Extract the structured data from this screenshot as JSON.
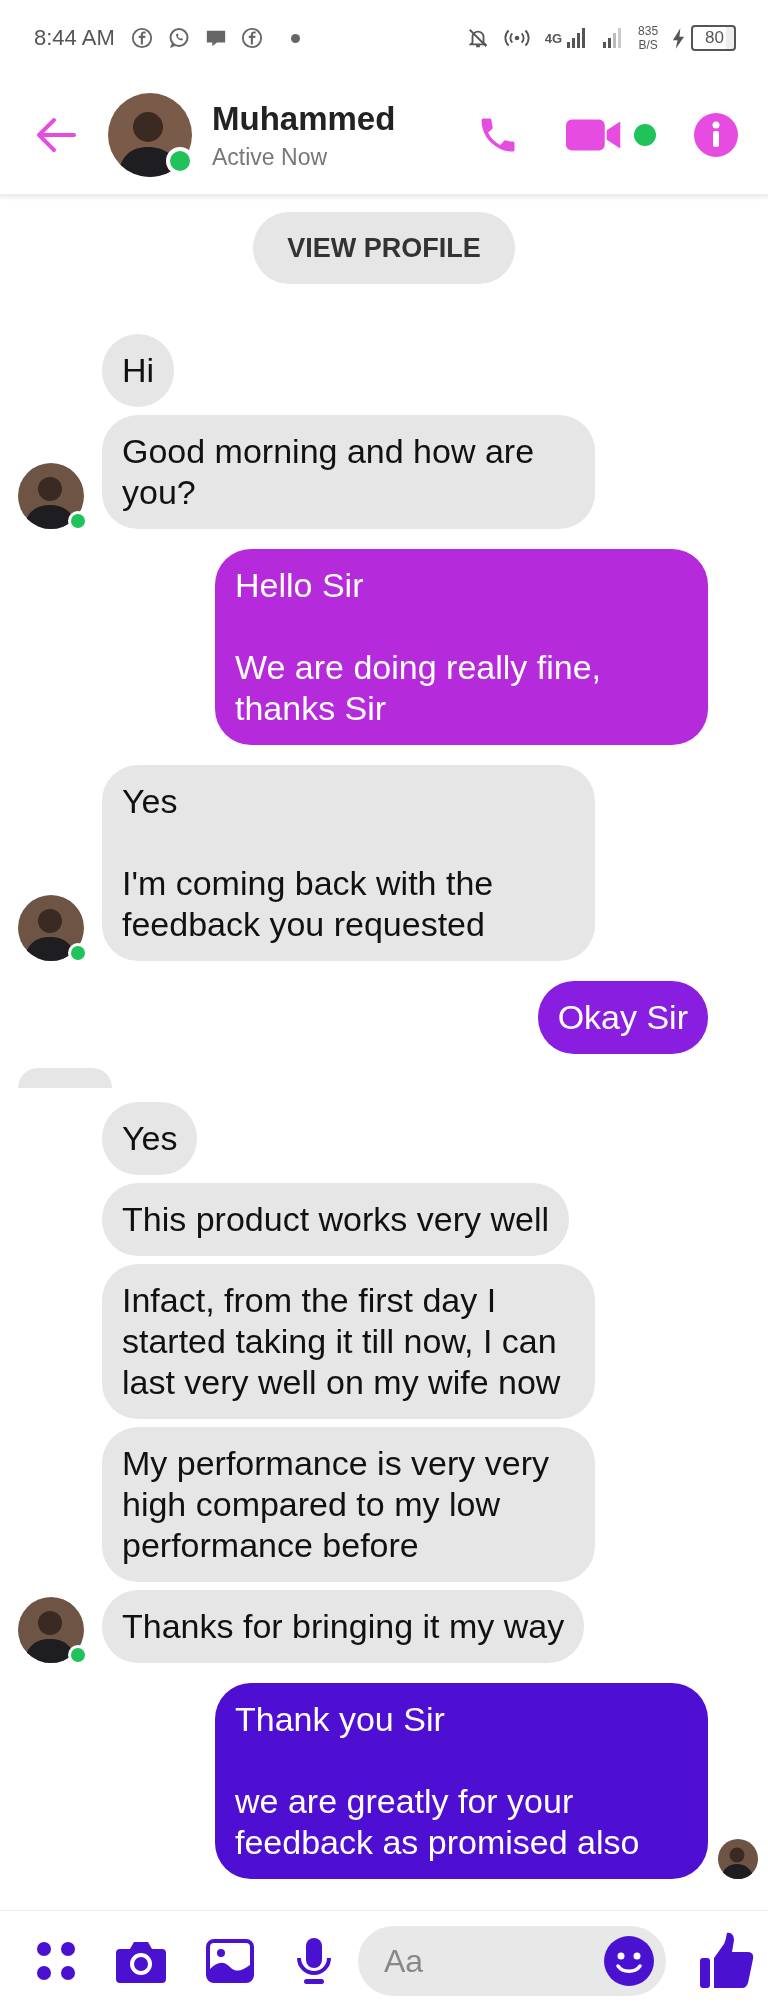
{
  "status_bar": {
    "time": "8:44 AM",
    "network": "4G",
    "speed_value": "835",
    "speed_unit": "B/S",
    "battery": "80"
  },
  "header": {
    "name": "Muhammed",
    "status": "Active Now",
    "online": true,
    "video_online": true
  },
  "view_profile": "VIEW PROFILE",
  "messages": [
    {
      "kind": "received",
      "text": "Hi",
      "avatar": false
    },
    {
      "kind": "received",
      "text": "Good morning and how are you?",
      "avatar": true
    },
    {
      "kind": "sent",
      "text": "Hello Sir\n\nWe are doing really fine, thanks Sir",
      "color": "#b52bdc",
      "seen": false
    },
    {
      "kind": "received",
      "text": "Yes\n\nI'm coming back with the feedback you requested",
      "avatar": true
    },
    {
      "kind": "sent",
      "text": "Okay Sir",
      "color": "#8a1ee0",
      "seen": false
    },
    {
      "kind": "partial"
    },
    {
      "kind": "received",
      "text": "Yes",
      "avatar": false
    },
    {
      "kind": "received",
      "text": "This product works very well",
      "avatar": false
    },
    {
      "kind": "received",
      "text": "Infact, from the first day I started taking it till now, I can last very well on my wife now",
      "avatar": false
    },
    {
      "kind": "received",
      "text": "My performance is very very high compared to my low performance before",
      "avatar": false
    },
    {
      "kind": "received",
      "text": "Thanks for bringing it my way",
      "avatar": true
    },
    {
      "kind": "sent",
      "text": "Thank you Sir\n\nwe are greatly for your feedback as promised also",
      "color": "#4e0fd2",
      "seen": true
    }
  ],
  "composer": {
    "placeholder": "Aa"
  }
}
